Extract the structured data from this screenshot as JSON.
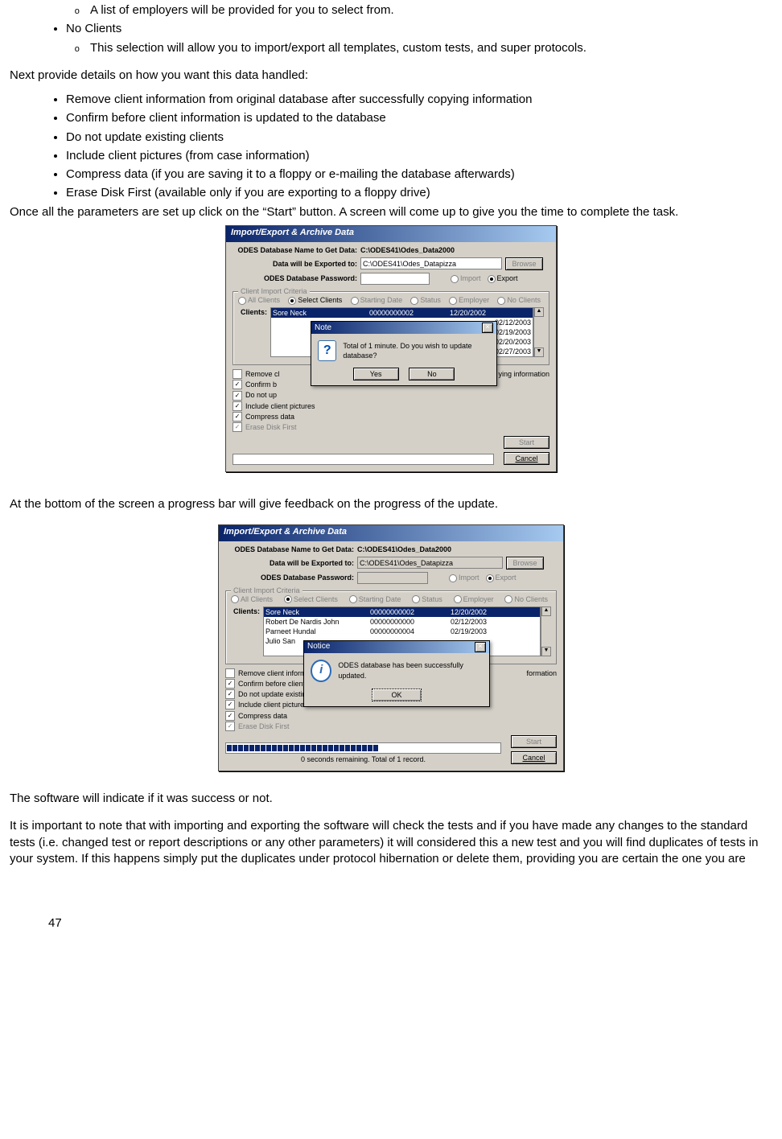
{
  "doc": {
    "circ1": "A list of employers will be provided for you to select from.",
    "bul_noclients": "No Clients",
    "circ2": "This selection will allow you to import/export all templates, custom tests, and super protocols.",
    "para1": "Next provide details on how you want this data handled:",
    "b1": "Remove client information from original database after successfully copying information",
    "b2": "Confirm before client information is updated to the database",
    "b3": "Do not update existing clients",
    "b4": "Include client pictures (from case information)",
    "b5": "Compress data (if you are saving it to a floppy or e-mailing the database afterwards)",
    "b6": "Erase Disk First (available only if you are exporting to a floppy drive)",
    "para2": "Once all the parameters are set up click on the “Start” button. A screen will come up to give you the time to complete the task.",
    "para3": "At the bottom of the screen a progress bar will give feedback on the progress of the update.",
    "para4": "The software will indicate if it was success or not.",
    "para5": "It is important to note that with importing and exporting the software will check the tests and if you have made any changes to the standard tests (i.e. changed test or report descriptions or any other parameters) it will considered this a new test and you will find duplicates of tests in your system. If this happens simply put the duplicates under protocol hibernation or delete them, providing you are certain the one you are",
    "pagenum": "47"
  },
  "dlg": {
    "title": "Import/Export & Archive Data",
    "lbl_dbname": "ODES Database Name to Get Data:",
    "val_dbname": "C:\\ODES41\\Odes_Data2000",
    "lbl_export": "Data will be Exported to:",
    "val_export": "C:\\ODES41\\Odes_Datapizza",
    "btn_browse": "Browse",
    "lbl_pwd": "ODES Database Password:",
    "rad_import": "Import",
    "rad_export": "Export",
    "grp_title": "Client Import Criteria",
    "rad_all": "All Clients",
    "rad_select": "Select Clients",
    "rad_sdate": "Starting Date",
    "rad_status": "Status",
    "rad_emp": "Employer",
    "rad_nc": "No Clients",
    "lbl_clients": "Clients:",
    "rows_a": [
      {
        "c1": "Sore Neck",
        "c2": "00000000002",
        "c3": "12/20/2002"
      }
    ],
    "rows_a_dates": [
      "02/12/2003",
      "02/19/2003",
      "02/20/2003",
      "02/27/2003"
    ],
    "rows_b": [
      {
        "c1": "Sore Neck",
        "c2": "00000000002",
        "c3": "12/20/2002"
      },
      {
        "c1": "Robert De Nardis John",
        "c2": "00000000000",
        "c3": "02/12/2003"
      },
      {
        "c1": "Parneet Hundal",
        "c2": "00000000004",
        "c3": "02/19/2003"
      },
      {
        "c1": "Julio San",
        "c2": "",
        "c3": ""
      }
    ],
    "chk1a": "Remove cl",
    "chk1b": "Remove client inform",
    "chk_suffix": "ying information",
    "chk_suffix2": "formation",
    "chk2a": "Confirm b",
    "chk2b": "Confirm before client",
    "chk3a": "Do not up",
    "chk3b": "Do not update existin",
    "chk4": "Include client pictures",
    "chk4b": "Include client picture",
    "chk5": "Compress data",
    "chk6": "Erase Disk First",
    "btn_start": "Start",
    "btn_cancel": "Cancel",
    "prog_text": "0 seconds remaining. Total of 1 record."
  },
  "note": {
    "title": "Note",
    "msg": "Total of 1 minute. Do you wish to update database?",
    "yes": "Yes",
    "no": "No",
    "close": "×"
  },
  "notice": {
    "title": "Notice",
    "msg": "ODES database has been successfully updated.",
    "ok": "OK",
    "close": "×"
  }
}
